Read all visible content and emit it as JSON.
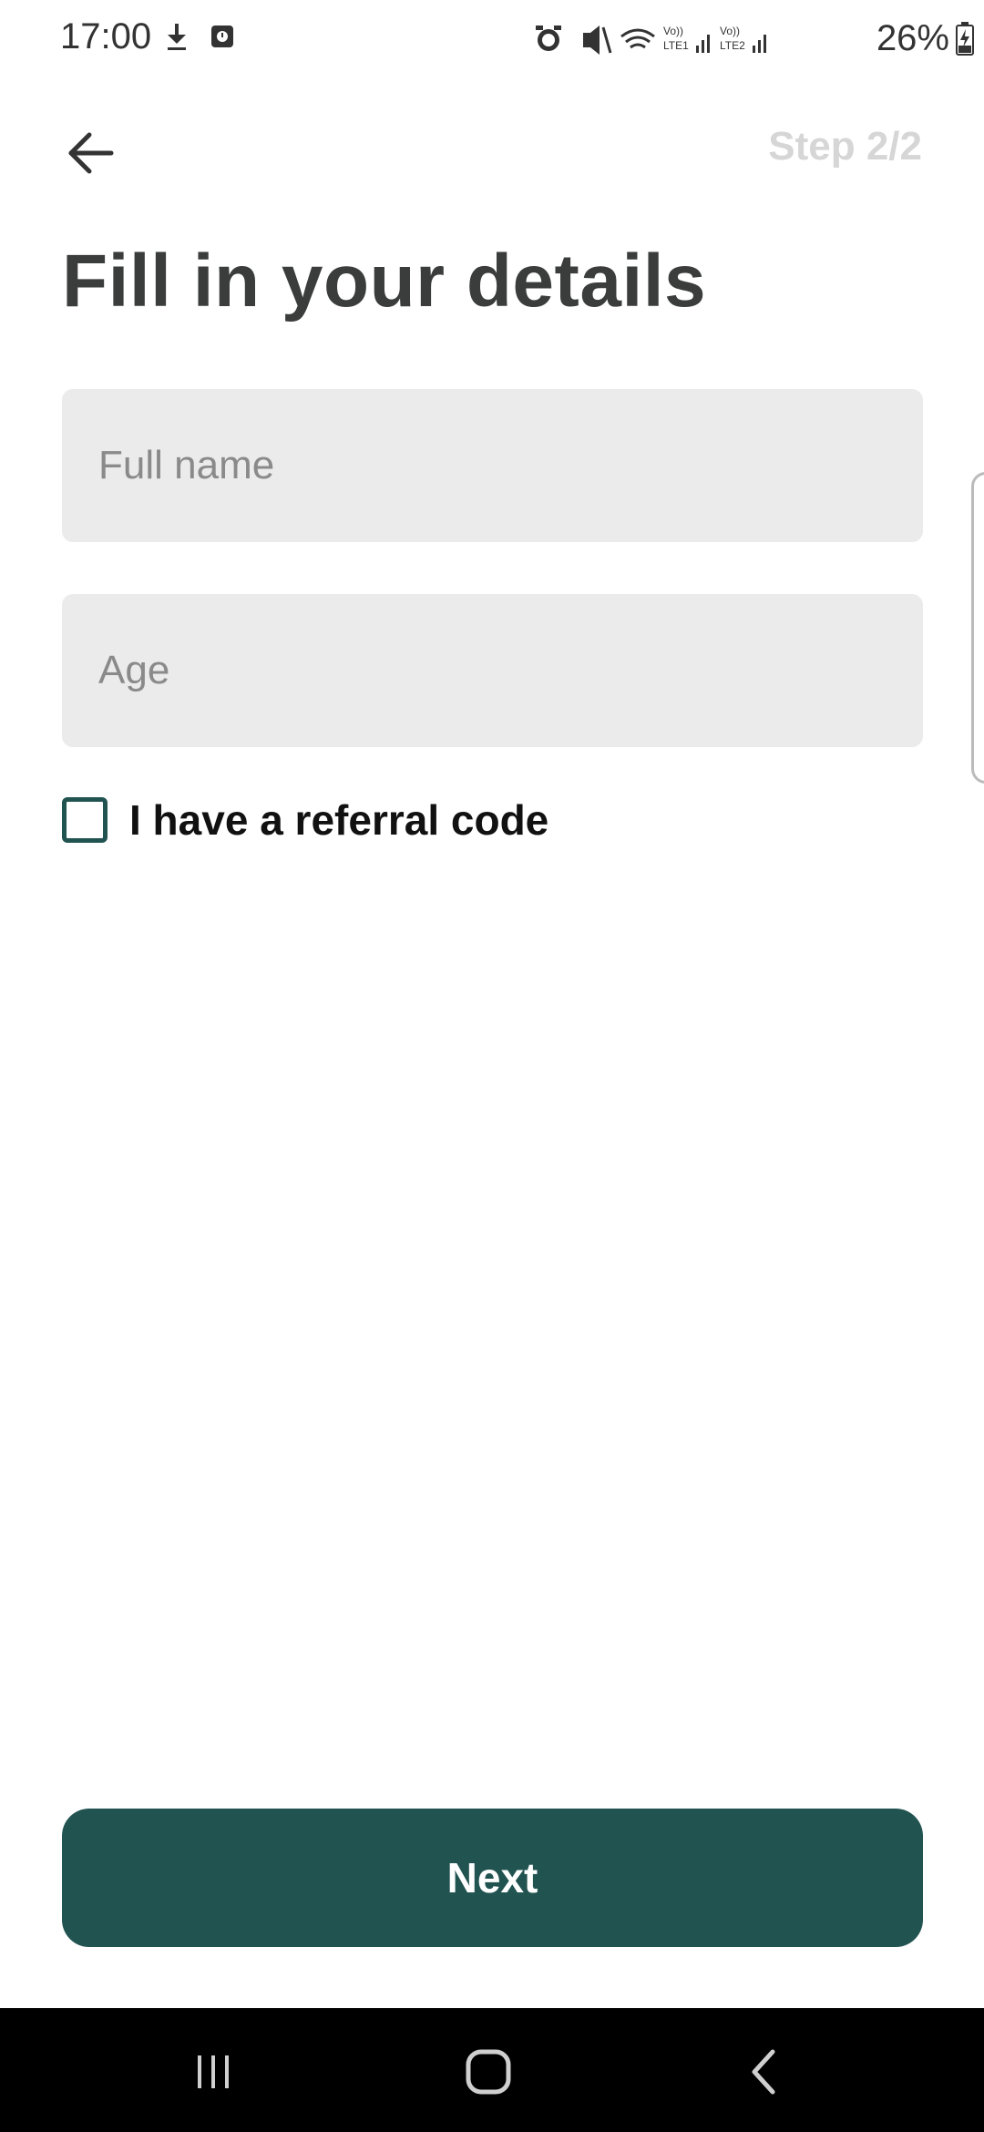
{
  "status_bar": {
    "time": "17:00",
    "battery_percent": "26%",
    "icons_left": [
      "download-icon",
      "screen-record-icon"
    ],
    "icons_right": [
      "alarm-icon",
      "mute-icon",
      "wifi-icon",
      "volte-lte1-signal-icon",
      "volte-lte2-signal-icon",
      "battery-charging-icon"
    ]
  },
  "header": {
    "back_icon": "arrow-left-icon",
    "step_label": "Step 2/2"
  },
  "page": {
    "title": "Fill in your details"
  },
  "form": {
    "full_name": {
      "placeholder": "Full name",
      "value": ""
    },
    "age": {
      "placeholder": "Age",
      "value": ""
    },
    "referral_checkbox": {
      "label": "I have a referral code",
      "checked": false
    }
  },
  "actions": {
    "next_label": "Next"
  },
  "nav_bar": {
    "items": [
      "recents-icon",
      "home-icon",
      "back-icon"
    ]
  },
  "colors": {
    "accent": "#215351",
    "field_background": "#ebebeb",
    "title": "#3a3d3c",
    "step_label": "#d6d6d6"
  }
}
